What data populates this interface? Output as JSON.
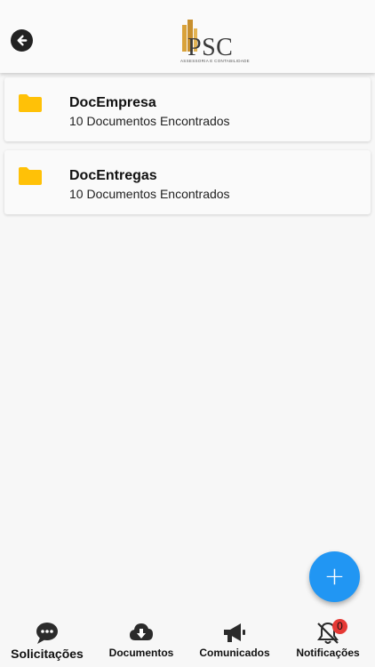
{
  "header": {
    "back_icon": "arrow-left-circle-icon",
    "logo": {
      "name": "PSC",
      "tagline": "ASSESSORIA E CONTABILIDADE"
    }
  },
  "folders": [
    {
      "icon": "folder-icon",
      "title": "DocEmpresa",
      "subtitle": "10 Documentos Encontrados"
    },
    {
      "icon": "folder-icon",
      "title": "DocEntregas",
      "subtitle": "10 Documentos Encontrados"
    }
  ],
  "fab": {
    "label": "+",
    "icon": "plus-icon",
    "color": "#2196f3"
  },
  "bottom_nav": [
    {
      "label": "Solicitações",
      "icon": "chat-bubble-icon",
      "active": true
    },
    {
      "label": "Documentos",
      "icon": "cloud-download-icon",
      "active": false
    },
    {
      "label": "Comunicados",
      "icon": "megaphone-icon",
      "active": false
    },
    {
      "label": "Notificações",
      "icon": "bell-off-icon",
      "active": false,
      "badge": "0"
    }
  ],
  "colors": {
    "folder": "#ffc107",
    "logo_gold": "#d9a23a",
    "badge": "#e53935",
    "background": "#f7f7f7"
  }
}
